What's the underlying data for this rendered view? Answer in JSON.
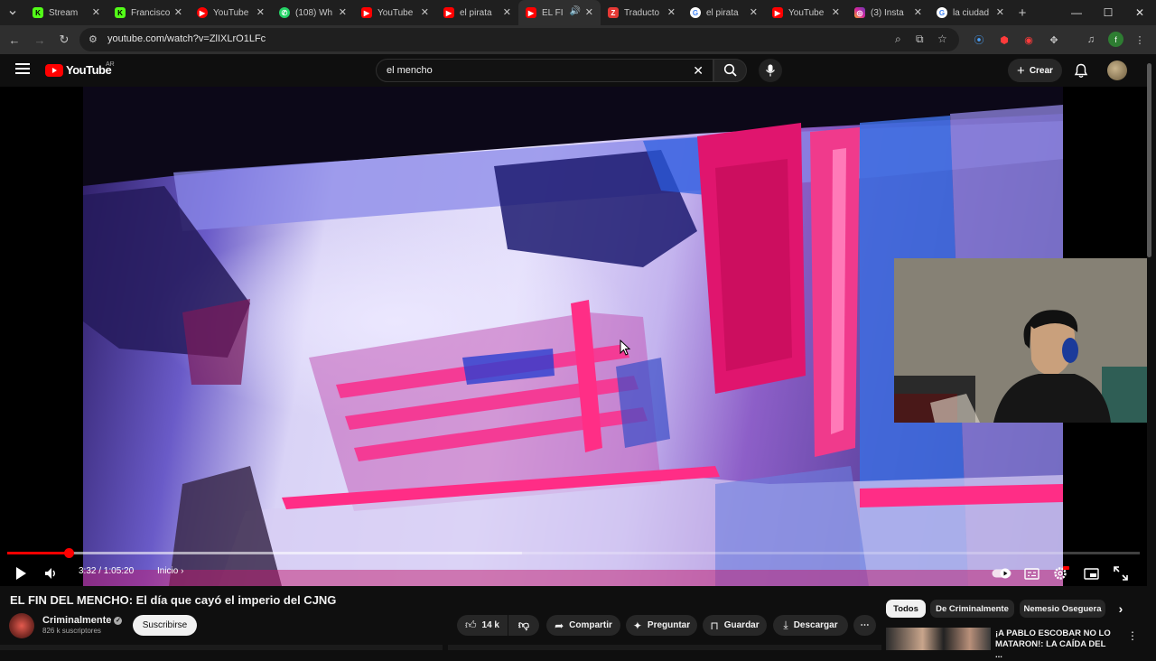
{
  "browser": {
    "tabs": [
      {
        "title": "Stream",
        "icon": "kick-icon",
        "color": "#53fc18"
      },
      {
        "title": "Francisco",
        "icon": "kick-icon",
        "color": "#53fc18"
      },
      {
        "title": "YouTube",
        "icon": "youtube-icon",
        "color": "#ff0000"
      },
      {
        "title": "(108) Wh",
        "icon": "whatsapp-icon",
        "color": "#25d366"
      },
      {
        "title": "YouTube",
        "icon": "youtube-icon",
        "color": "#ff0000"
      },
      {
        "title": "el pirata",
        "icon": "youtube-icon",
        "color": "#ff0000"
      },
      {
        "title": "EL FI",
        "icon": "youtube-icon",
        "color": "#ff0000"
      },
      {
        "title": "Traducto",
        "icon": "translate-icon",
        "color": "#e53935"
      },
      {
        "title": "el pirata",
        "icon": "google-icon",
        "color": "#ffffff"
      },
      {
        "title": "YouTube",
        "icon": "youtube-icon",
        "color": "#ff0000"
      },
      {
        "title": "(3) Insta",
        "icon": "instagram-icon",
        "color": "#d6249f"
      },
      {
        "title": "la ciudad",
        "icon": "google-icon",
        "color": "#ffffff"
      }
    ],
    "active_tab": 6,
    "url": "youtube.com/watch?v=ZlIXLrO1LFc",
    "profile_initial": "f"
  },
  "youtube": {
    "logo_text": "YouTube",
    "country": "AR",
    "search_query": "el mencho",
    "create_label": "Crear"
  },
  "player": {
    "current_time": "3:32",
    "duration": "1:05:20",
    "time_display": "3:32 / 1:05:20",
    "chapter": "Inicio",
    "played_fraction": 0.054
  },
  "video": {
    "title": "EL FIN DEL MENCHO: El día que cayó el imperio del CJNG",
    "channel": "Criminalmente",
    "subscribers": "826 k suscriptores",
    "subscribe_label": "Suscribirse",
    "likes": "14 k",
    "share_label": "Compartir",
    "ask_label": "Preguntar",
    "save_label": "Guardar",
    "download_label": "Descargar"
  },
  "chips": [
    "Todos",
    "De Criminalmente",
    "Nemesio Oseguera"
  ],
  "recommended": {
    "title": "¡A PABLO ESCOBAR NO LO MATARON!: LA CAÍDA DEL ..."
  },
  "colors": {
    "brand_red": "#ff0000",
    "background": "#0f0f0f"
  }
}
